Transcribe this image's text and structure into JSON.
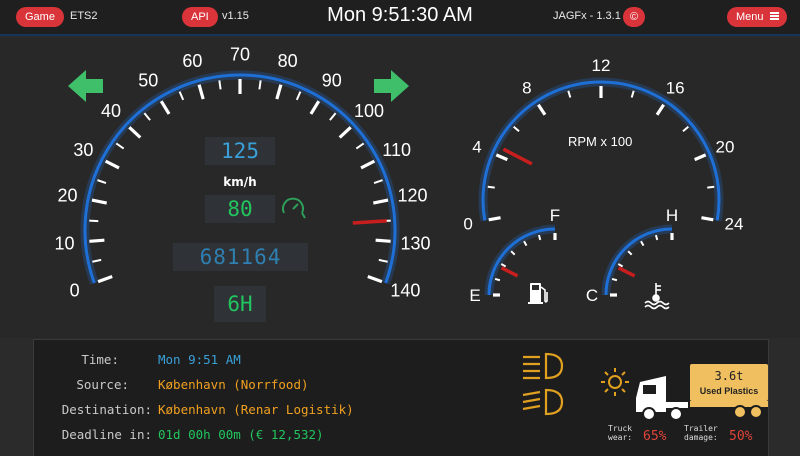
{
  "header": {
    "game_button": "Game",
    "game_name": "ETS2",
    "api_button": "API",
    "api_version": "v1.15",
    "clock": "Mon 9:51:30 AM",
    "app_name": "JAGFx - 1.3.1",
    "copyright_button": "©",
    "menu_button": "Menu",
    "menu_icon": "hamburger-icon"
  },
  "colors": {
    "accent_red": "#d9343a",
    "gauge_blue": "#1e6fd6",
    "digital_cyan": "#3aa0d8",
    "digital_green": "#22c55e",
    "orange": "#f0a020"
  },
  "speedometer": {
    "ticks": [
      "0",
      "10",
      "20",
      "30",
      "40",
      "50",
      "60",
      "70",
      "80",
      "90",
      "100",
      "110",
      "120",
      "130",
      "140"
    ],
    "speed_limit": "125",
    "unit": "km/h",
    "speed": "80",
    "odometer": "681164",
    "gear": "6H",
    "needle_value": 0,
    "redline_value": 125,
    "left_indicator": "arrow-left-icon",
    "right_indicator": "arrow-right-icon",
    "cruise_icon": "cruise-control-icon"
  },
  "rpm": {
    "ticks": [
      "0",
      "4",
      "8",
      "12",
      "16",
      "20",
      "24"
    ],
    "label": "RPM x 100",
    "needle_value": 4.5
  },
  "fuel": {
    "min": "E",
    "max": "F",
    "level": 0.3,
    "icon": "fuel-pump-icon"
  },
  "temperature": {
    "min": "C",
    "max": "H",
    "level": 0.3,
    "icon": "coolant-temp-icon"
  },
  "job": {
    "time_label": "Time:",
    "time_value": "Mon 9:51 AM",
    "source_label": "Source:",
    "source_value": "København (Norrfood)",
    "destination_label": "Destination:",
    "destination_value": "København (Renar Logistik)",
    "deadline_label": "Deadline in:",
    "deadline_value": "01d 00h 00m (€ 12,532)"
  },
  "truck": {
    "cargo_weight": "3.6t",
    "cargo_name": "Used Plastics",
    "truck_wear_label_1": "Truck",
    "truck_wear_label_2": "wear:",
    "truck_wear_value": "65%",
    "trailer_damage_label_1": "Trailer",
    "trailer_damage_label_2": "damage:",
    "trailer_damage_value": "50%",
    "headlight_low_icon": "low-beam-icon",
    "headlight_high_icon": "high-beam-icon",
    "beacon_icon": "beacon-light-icon"
  }
}
